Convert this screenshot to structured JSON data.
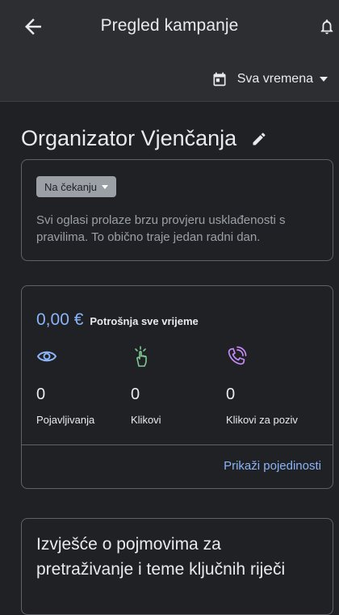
{
  "appbar": {
    "title": "Pregled kampanje",
    "back_icon": "arrow-left-icon",
    "notification_icon": "bell-icon"
  },
  "date_filter": {
    "label": "Sva vremena",
    "icon": "calendar-icon"
  },
  "campaign": {
    "name": "Organizator Vjenčanja",
    "edit_icon": "pencil-icon"
  },
  "status": {
    "chip_label": "Na čekanju",
    "description": "Svi oglasi prolaze brzu provjeru usklađenosti s pravilima. To obično traje jedan radni dan."
  },
  "stats": {
    "spend_amount": "0,00 €",
    "spend_label": "Potrošnja sve vrijeme",
    "metrics": [
      {
        "value": "0",
        "label": "Pojavljivanja",
        "icon": "eye-icon",
        "color": "#8ab4f8"
      },
      {
        "value": "0",
        "label": "Klikovi",
        "icon": "tap-icon",
        "color": "#81c995"
      },
      {
        "value": "0",
        "label": "Klikovi za poziv",
        "icon": "phone-call-icon",
        "color": "#c58af9"
      }
    ],
    "details_link": "Prikaži pojedinosti"
  },
  "report": {
    "title": "Izvješće o pojmovima za pretraživanje i teme ključnih riječi"
  },
  "colors": {
    "background": "#202124",
    "appbar": "#2d2e31",
    "accent": "#8ab4f8",
    "chip": "#9aa0a6"
  }
}
